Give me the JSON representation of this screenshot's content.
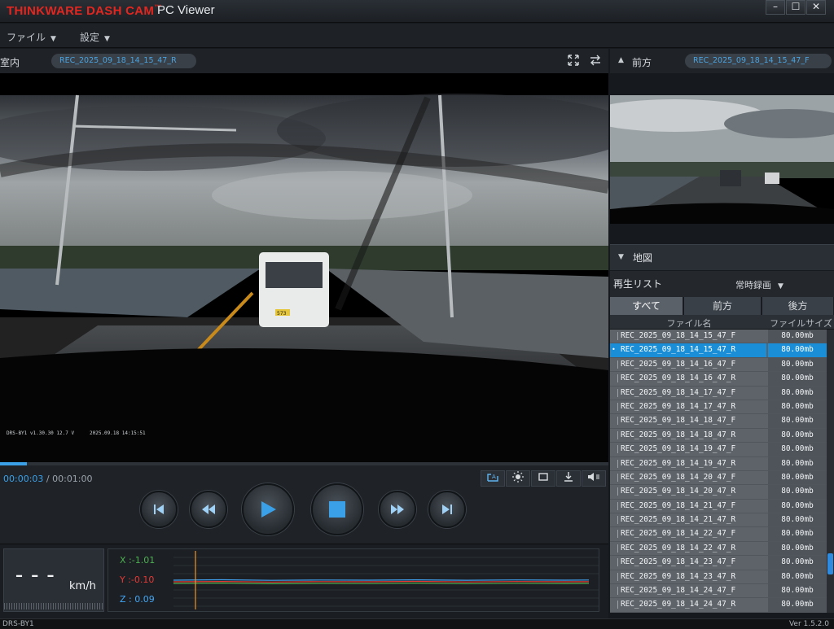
{
  "titlebar": {
    "brand": "THINKWARE DASH CAM",
    "tm": "™",
    "subtitle": "PC Viewer",
    "minimize": "–",
    "maximize": "☐",
    "close": "✕"
  },
  "menu": {
    "file": "ファイル",
    "settings": "設定"
  },
  "left_header": {
    "label": "室内",
    "file": "REC_2025_09_18_14_15_47_R"
  },
  "right_header": {
    "label": "前方",
    "file": "REC_2025_09_18_14_15_47_F"
  },
  "video": {
    "overlay_left": "DRS-BY1  v1.30.30  12.7 V",
    "overlay_right": "2025.09.18 14:15:51",
    "plate": "573"
  },
  "playback": {
    "current": "00:00:03",
    "sep": " / ",
    "total": "00:01:00",
    "progress": 0.044
  },
  "sensor": {
    "speed": "– – –",
    "unit": "km/h",
    "x": "X :-1.01",
    "y": "Y :-0.10",
    "z": "Z : 0.09"
  },
  "panel": {
    "map": "地図",
    "playlist": "再生リスト",
    "mode": "常時録画",
    "tabs": [
      "すべて",
      "前方",
      "後方"
    ],
    "col_name": "ファイル名",
    "col_size": "ファイルサイズ"
  },
  "files": [
    {
      "name": "REC_2025_09_18_14_15_47_F",
      "size": "80.00mb"
    },
    {
      "name": "REC_2025_09_18_14_15_47_R",
      "size": "80.00mb"
    },
    {
      "name": "REC_2025_09_18_14_16_47_F",
      "size": "80.00mb"
    },
    {
      "name": "REC_2025_09_18_14_16_47_R",
      "size": "80.00mb"
    },
    {
      "name": "REC_2025_09_18_14_17_47_F",
      "size": "80.00mb"
    },
    {
      "name": "REC_2025_09_18_14_17_47_R",
      "size": "80.00mb"
    },
    {
      "name": "REC_2025_09_18_14_18_47_F",
      "size": "80.00mb"
    },
    {
      "name": "REC_2025_09_18_14_18_47_R",
      "size": "80.00mb"
    },
    {
      "name": "REC_2025_09_18_14_19_47_F",
      "size": "80.00mb"
    },
    {
      "name": "REC_2025_09_18_14_19_47_R",
      "size": "80.00mb"
    },
    {
      "name": "REC_2025_09_18_14_20_47_F",
      "size": "80.00mb"
    },
    {
      "name": "REC_2025_09_18_14_20_47_R",
      "size": "80.00mb"
    },
    {
      "name": "REC_2025_09_18_14_21_47_F",
      "size": "80.00mb"
    },
    {
      "name": "REC_2025_09_18_14_21_47_R",
      "size": "80.00mb"
    },
    {
      "name": "REC_2025_09_18_14_22_47_F",
      "size": "80.00mb"
    },
    {
      "name": "REC_2025_09_18_14_22_47_R",
      "size": "80.00mb"
    },
    {
      "name": "REC_2025_09_18_14_23_47_F",
      "size": "80.00mb"
    },
    {
      "name": "REC_2025_09_18_14_23_47_R",
      "size": "80.00mb"
    },
    {
      "name": "REC_2025_09_18_14_24_47_F",
      "size": "80.00mb"
    },
    {
      "name": "REC_2025_09_18_14_24_47_R",
      "size": "80.00mb"
    }
  ],
  "selected_index": 1,
  "status": {
    "model": "DRS-BY1",
    "version": "Ver 1.5.2.0"
  },
  "colors": {
    "accent": "#3aa0e8",
    "brand": "#e3261f",
    "x_axis": "#4caf50",
    "y_axis": "#e53935",
    "z_axis": "#42a5f5"
  }
}
